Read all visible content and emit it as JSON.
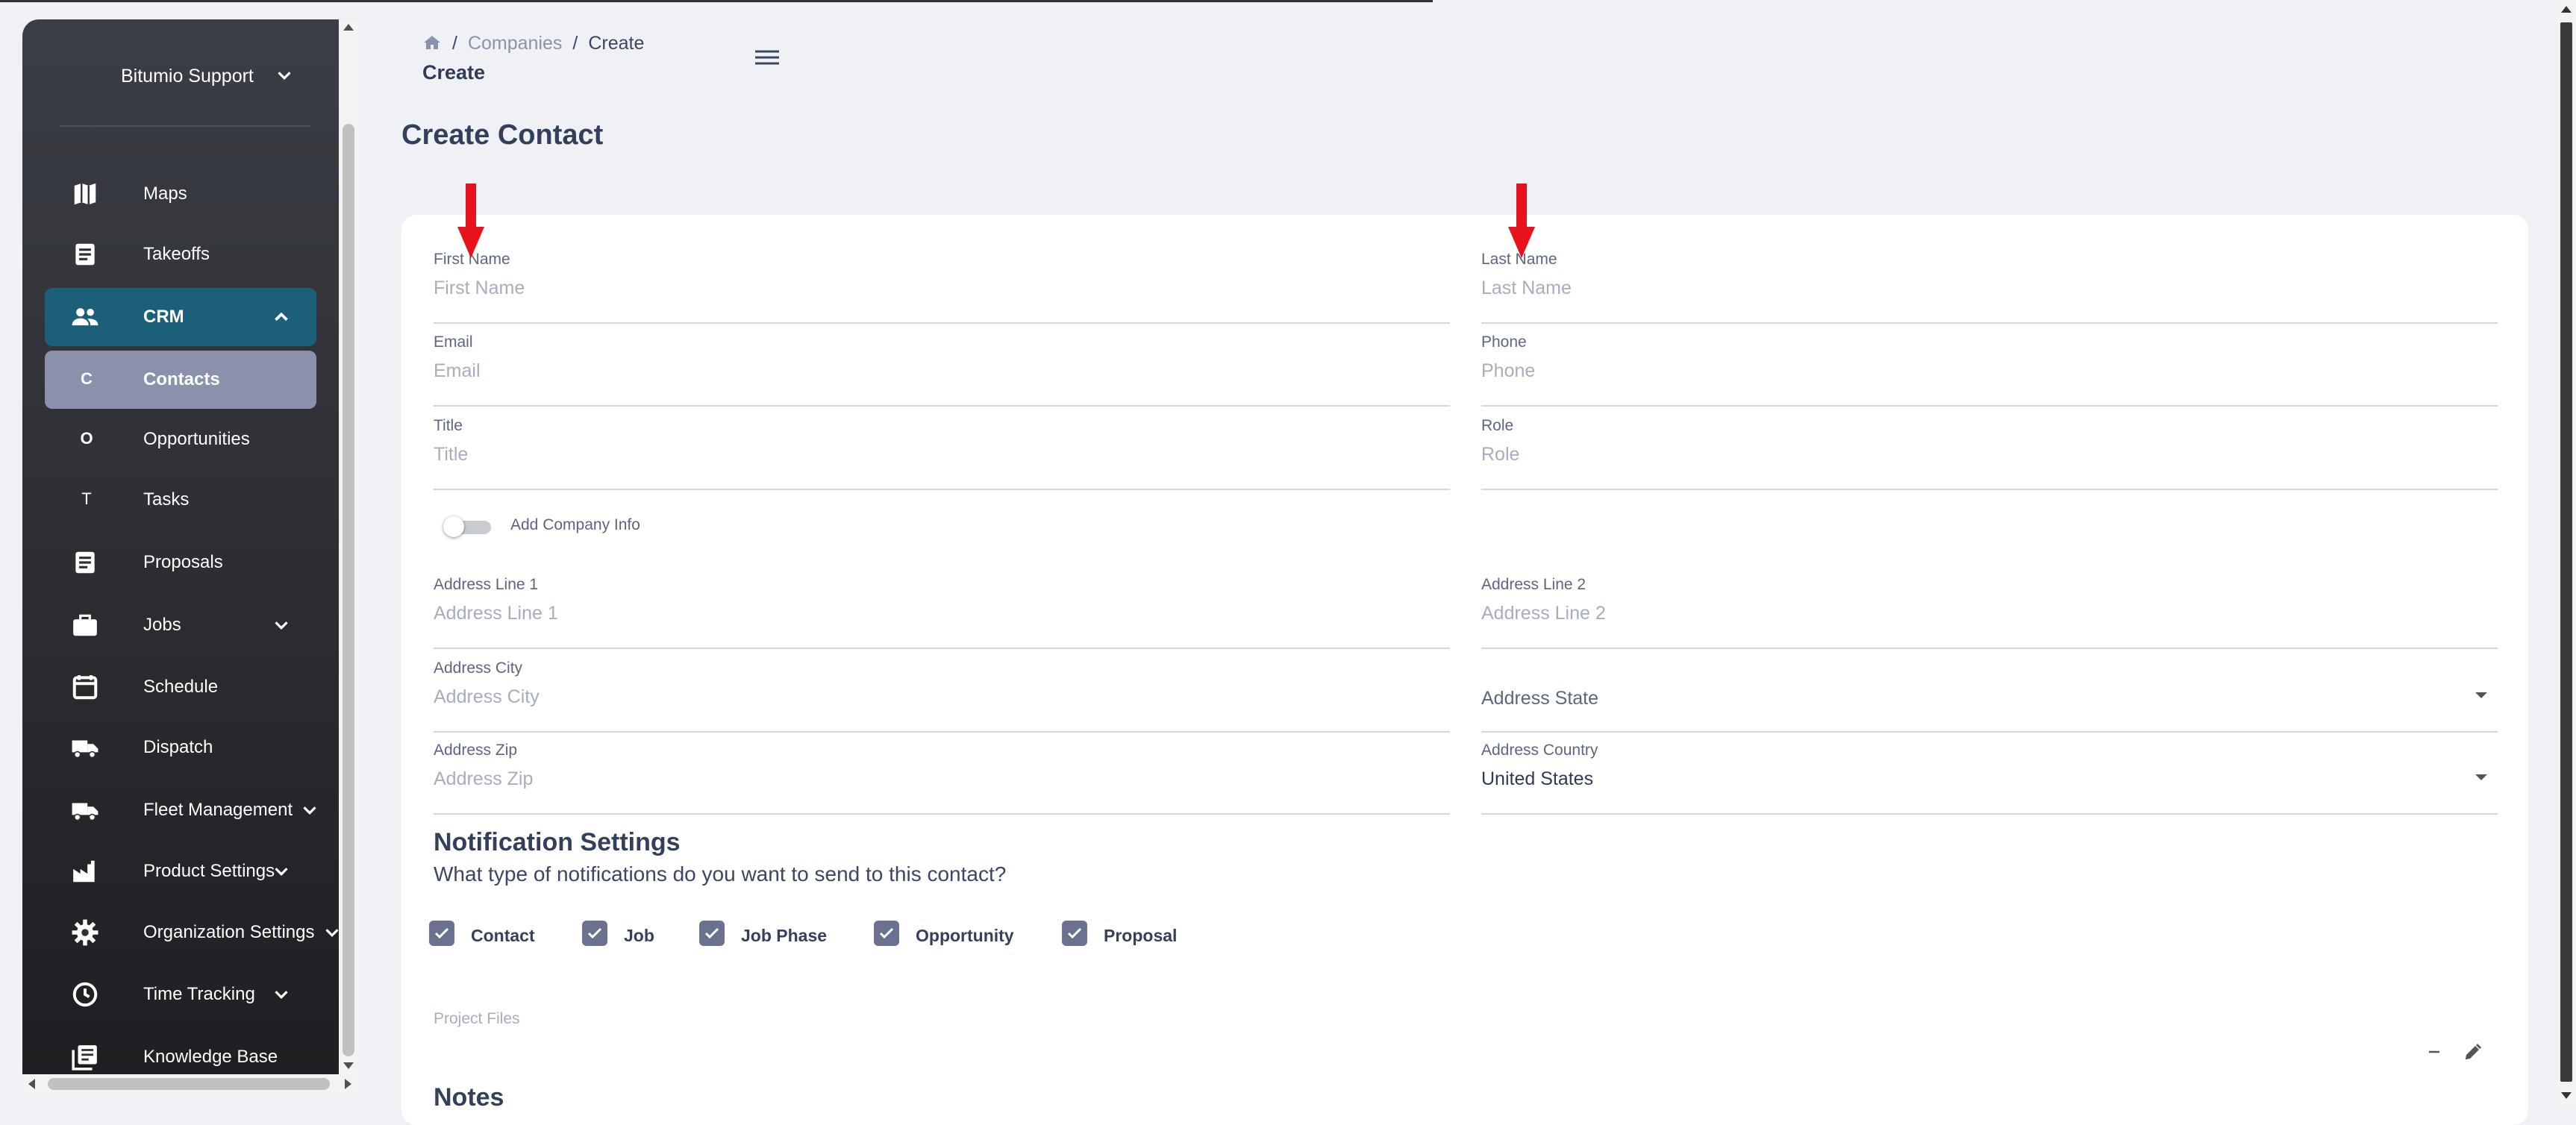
{
  "sidebar": {
    "user": "Bitumio Support",
    "items": [
      {
        "label": "Maps",
        "icon": "map-icon"
      },
      {
        "label": "Takeoffs",
        "icon": "document-icon"
      },
      {
        "label": "CRM",
        "icon": "people-icon",
        "expanded": true
      },
      {
        "label": "Contacts",
        "letter": "C",
        "selected": true
      },
      {
        "label": "Opportunities",
        "letter": "O"
      },
      {
        "label": "Tasks",
        "letter": "T"
      },
      {
        "label": "Proposals",
        "icon": "document-icon"
      },
      {
        "label": "Jobs",
        "icon": "briefcase-icon"
      },
      {
        "label": "Schedule",
        "icon": "calendar-icon"
      },
      {
        "label": "Dispatch",
        "icon": "truck-icon"
      },
      {
        "label": "Fleet Management",
        "icon": "truck-icon"
      },
      {
        "label": "Product Settings",
        "icon": "factory-icon"
      },
      {
        "label": "Organization Settings",
        "icon": "gear-icon"
      },
      {
        "label": "Time Tracking",
        "icon": "clock-icon"
      },
      {
        "label": "Knowledge Base",
        "icon": "library-icon"
      }
    ]
  },
  "header": {
    "breadcrumb": [
      "Companies",
      "Create"
    ],
    "subtitle": "Create"
  },
  "page": {
    "title": "Create Contact"
  },
  "form": {
    "first_name": {
      "label": "First Name",
      "placeholder": "First Name"
    },
    "last_name": {
      "label": "Last Name",
      "placeholder": "Last Name"
    },
    "email": {
      "label": "Email",
      "placeholder": "Email"
    },
    "phone": {
      "label": "Phone",
      "placeholder": "Phone"
    },
    "title": {
      "label": "Title",
      "placeholder": "Title"
    },
    "role": {
      "label": "Role",
      "placeholder": "Role"
    },
    "company_toggle_label": "Add Company Info",
    "address_line1": {
      "label": "Address Line 1",
      "placeholder": "Address Line 1"
    },
    "address_line2": {
      "label": "Address Line 2",
      "placeholder": "Address Line 2"
    },
    "address_city": {
      "label": "Address City",
      "placeholder": "Address City"
    },
    "address_state": {
      "placeholder": "Address State"
    },
    "address_zip": {
      "label": "Address Zip",
      "placeholder": "Address Zip"
    },
    "address_country": {
      "label": "Address Country",
      "value": "United States"
    }
  },
  "notifications": {
    "title": "Notification Settings",
    "subtitle": "What type of notifications do you want to send to this contact?",
    "options": [
      {
        "label": "Contact",
        "checked": true
      },
      {
        "label": "Job",
        "checked": true
      },
      {
        "label": "Job Phase",
        "checked": true
      },
      {
        "label": "Opportunity",
        "checked": true
      },
      {
        "label": "Proposal",
        "checked": true
      }
    ]
  },
  "files": {
    "label": "Project Files"
  },
  "notes": {
    "title": "Notes"
  },
  "colors": {
    "sidebar_active": "#1c5f78",
    "sidebar_selected": "#8b91ab",
    "checkbox": "#6b7290",
    "annotation_arrow": "#e8121c"
  }
}
